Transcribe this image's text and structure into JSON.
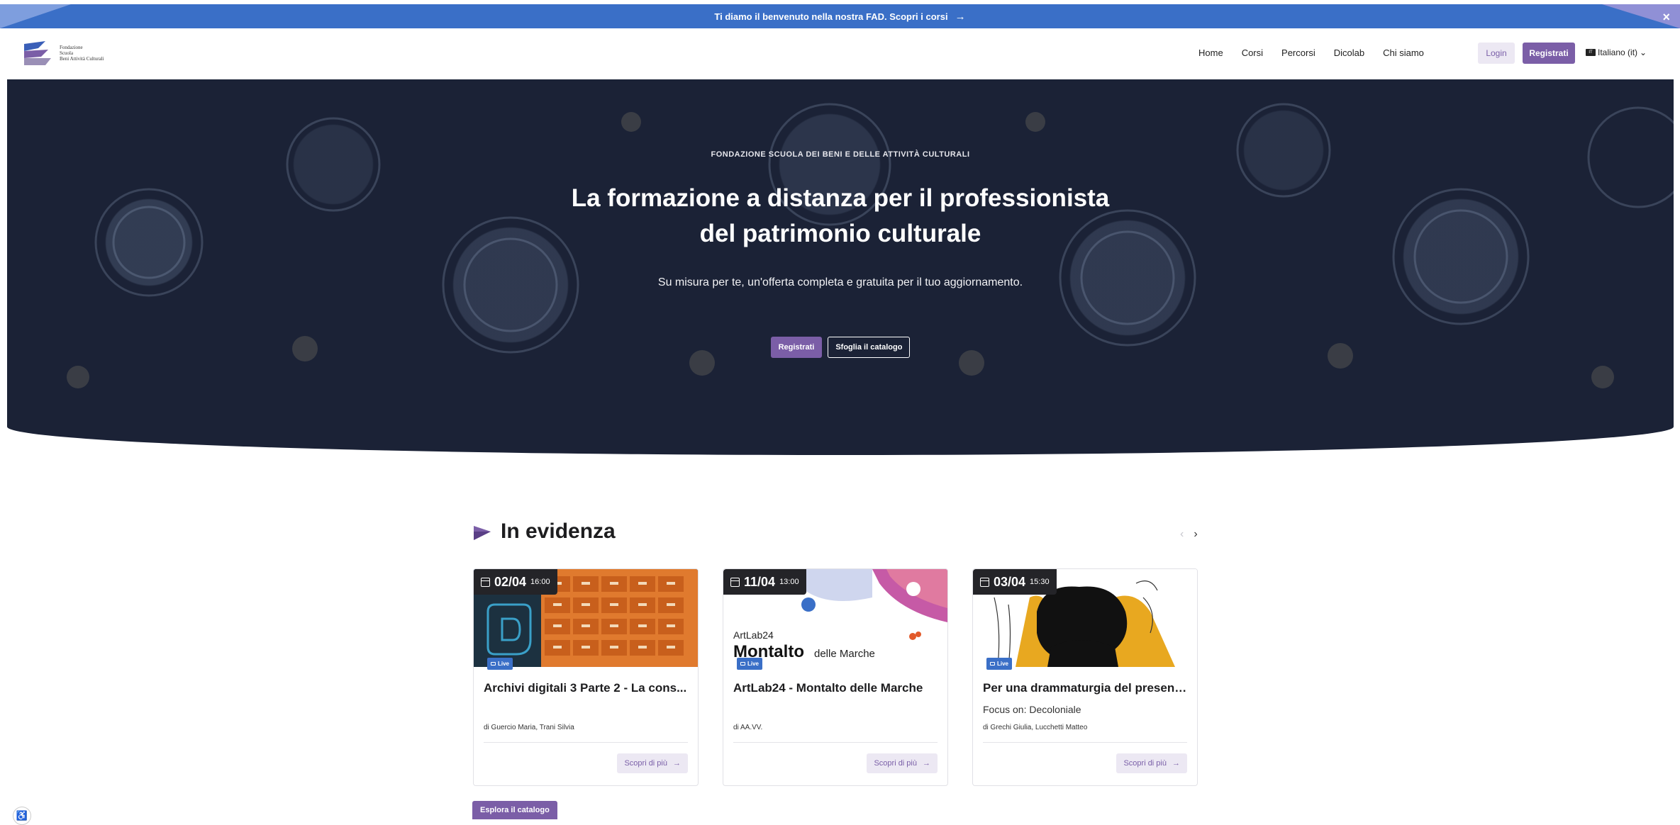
{
  "announcement": {
    "text": "Ti diamo il benvenuto nella nostra FAD. Scopri i corsi",
    "arrow": "→",
    "close": "×"
  },
  "logo": {
    "line1": "Fondazione",
    "line2": "Scuola",
    "line3": "Beni Attività Culturali"
  },
  "nav": [
    "Home",
    "Corsi",
    "Percorsi",
    "Dicolab",
    "Chi siamo"
  ],
  "auth": {
    "login": "Login",
    "register": "Registrati"
  },
  "language": {
    "flag": "IT",
    "label": "Italiano (it)",
    "caret": "⌄"
  },
  "hero": {
    "eyebrow": "FONDAZIONE SCUOLA DEI BENI E DELLE ATTIVITÀ CULTURALI",
    "title_line1": "La formazione a distanza per il professionista",
    "title_line2": "del patrimonio culturale",
    "subtitle": "Su misura per te, un'offerta completa e gratuita per il tuo aggiornamento.",
    "cta_primary": "Registrati",
    "cta_secondary": "Sfoglia il catalogo"
  },
  "featured": {
    "title": "In evidenza",
    "prev": "‹",
    "next": "›",
    "cards": [
      {
        "date": "02/04",
        "time": "16:00",
        "badge": "Live",
        "title": "Archivi digitali 3 Parte 2 - La cons...",
        "focus": "",
        "authors": "di Guercio Maria, Trani Silvia",
        "cta": "Scopri di più",
        "arrow": "→"
      },
      {
        "date": "11/04",
        "time": "13:00",
        "badge": "Live",
        "title": "ArtLab24 - Montalto delle Marche",
        "focus": "",
        "authors": "di AA.VV.",
        "cta": "Scopri di più",
        "arrow": "→",
        "img_line1": "ArtLab24",
        "img_line2": "Montalto",
        "img_line3": "delle Marche"
      },
      {
        "date": "03/04",
        "time": "15:30",
        "badge": "Live",
        "title": "Per una drammaturgia del present...",
        "focus": "Focus on: Decoloniale",
        "authors": "di Grechi Giulia, Lucchetti Matteo",
        "cta": "Scopri di più",
        "arrow": "→"
      }
    ]
  },
  "explore": "Esplora il catalogo",
  "colors": {
    "accent": "#7b5ea7",
    "topbar": "#3a6fc7",
    "hero_bg": "#1b2236"
  }
}
